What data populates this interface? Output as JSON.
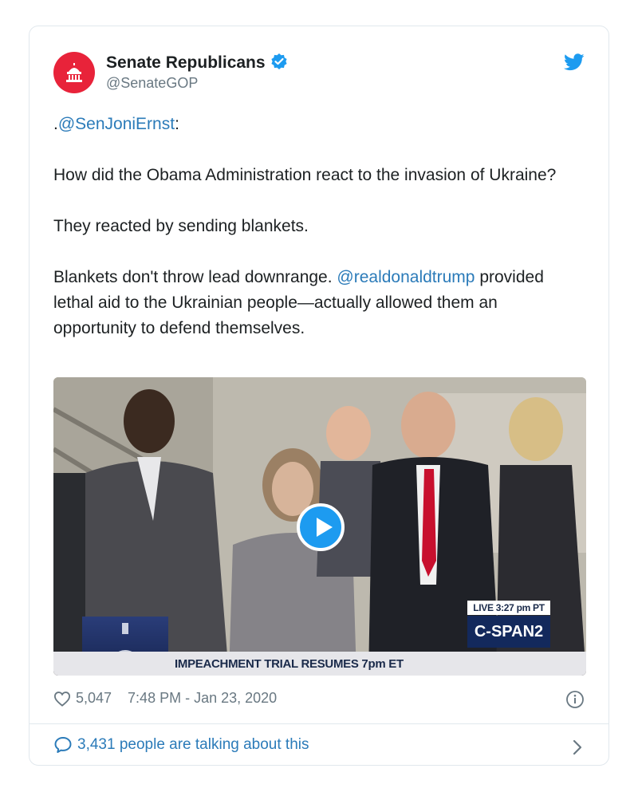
{
  "account": {
    "name": "Senate Republicans",
    "handle": "@SenateGOP"
  },
  "tweet": {
    "mention_prefix": ".",
    "mention": "@SenJoniErnst",
    "mention_suffix": ":",
    "paragraph_2": "How did the Obama Administration react to the invasion of Ukraine?",
    "paragraph_3": "They reacted by sending blankets.",
    "paragraph_4_start": "Blankets don't throw lead downrange. ",
    "paragraph_4_mention": "@realdonaldtrump",
    "paragraph_4_end": " provided lethal aid to the Ukrainian people—actually allowed them an opportunity to defend themselves."
  },
  "video": {
    "live_label": "LIVE  3:27 pm PT",
    "network": "C-SPAN2",
    "chyron": "IMPEACHMENT TRIAL RESUMES 7pm ET"
  },
  "footer": {
    "likes": "5,047",
    "timestamp": "7:48 PM - Jan 23, 2020",
    "talking": "3,431 people are talking about this"
  },
  "colors": {
    "avatar_bg": "#e8233a",
    "link": "#2b7bb9",
    "twitter_blue": "#1d9bf0",
    "cspan_navy": "#13295c"
  }
}
